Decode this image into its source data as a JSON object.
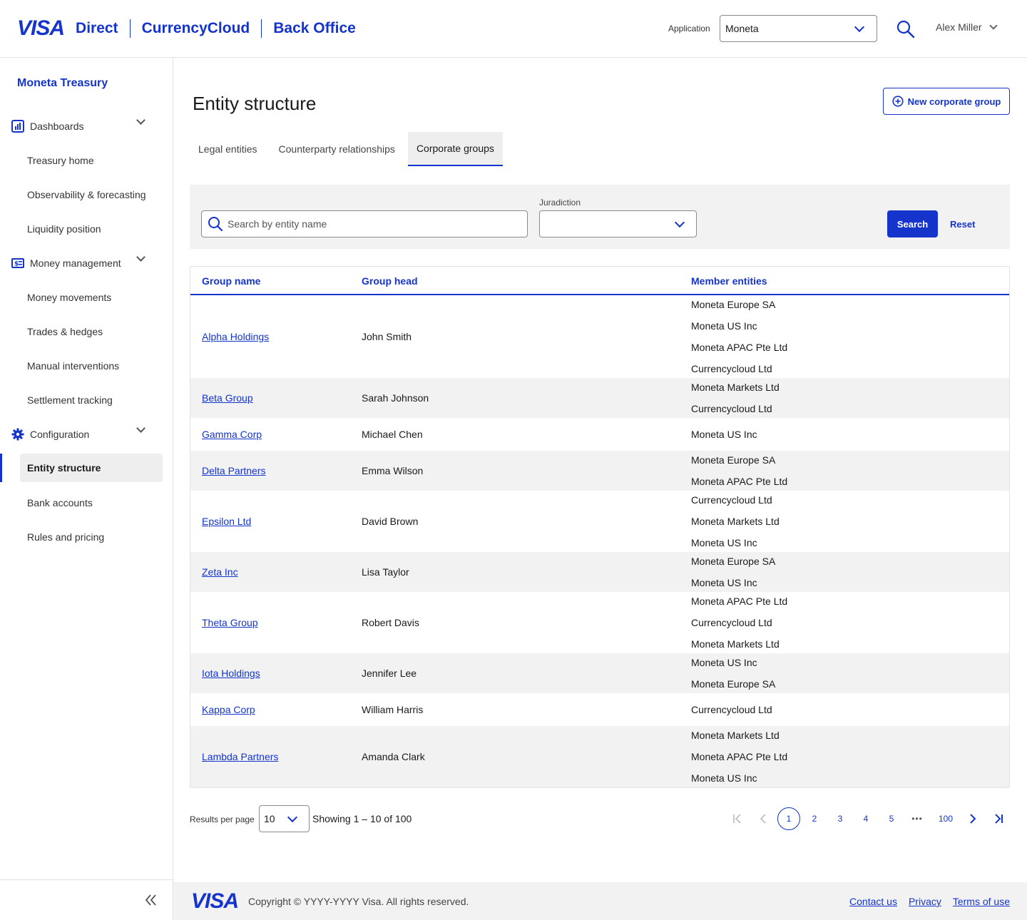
{
  "header": {
    "brand_logo": "VISA",
    "brand_items": [
      "Direct",
      "CurrencyCloud",
      "Back Office"
    ],
    "application_label": "Application",
    "application_value": "Moneta",
    "user_name": "Alex Miller"
  },
  "sidebar": {
    "title": "Moneta Treasury",
    "groups": [
      {
        "label": "Dashboards",
        "icon": "chart-icon",
        "items": [
          "Treasury home",
          "Observability & forecasting",
          "Liquidity position"
        ]
      },
      {
        "label": "Money management",
        "icon": "money-icon",
        "items": [
          "Money movements",
          "Trades & hedges",
          "Manual interventions",
          "Settlement tracking"
        ]
      },
      {
        "label": "Configuration",
        "icon": "gear-icon",
        "items": [
          "Entity structure",
          "Bank accounts",
          "Rules and pricing"
        ]
      }
    ],
    "active_item": "Entity structure"
  },
  "main": {
    "title": "Entity structure",
    "new_button_label": "New corporate group",
    "tabs": [
      "Legal entities",
      "Counterparty relationships",
      "Corporate groups"
    ],
    "active_tab": "Corporate groups",
    "filter": {
      "search_placeholder": "Search by entity name",
      "jurisdiction_label": "Juradiction",
      "jurisdiction_value": "",
      "search_button": "Search",
      "reset_button": "Reset"
    },
    "table": {
      "columns": [
        "Group name",
        "Group head",
        "Member entities"
      ],
      "rows": [
        {
          "group": "Alpha Holdings",
          "head": "John Smith",
          "members": [
            "Moneta Europe SA",
            "Moneta US Inc",
            "Moneta APAC Pte Ltd",
            "Currencycloud Ltd"
          ]
        },
        {
          "group": "Beta Group",
          "head": "Sarah Johnson",
          "members": [
            "Moneta Markets Ltd",
            "Currencycloud Ltd"
          ]
        },
        {
          "group": "Gamma Corp",
          "head": "Michael Chen",
          "members": [
            "Moneta US Inc"
          ]
        },
        {
          "group": "Delta Partners",
          "head": "Emma Wilson",
          "members": [
            "Moneta Europe SA",
            "Moneta APAC Pte Ltd"
          ]
        },
        {
          "group": "Epsilon Ltd",
          "head": "David Brown",
          "members": [
            "Currencycloud Ltd",
            "Moneta Markets Ltd",
            "Moneta US Inc"
          ]
        },
        {
          "group": "Zeta Inc",
          "head": "Lisa Taylor",
          "members": [
            "Moneta Europe SA",
            "Moneta US Inc"
          ]
        },
        {
          "group": "Theta Group",
          "head": "Robert Davis",
          "members": [
            "Moneta APAC Pte Ltd",
            "Currencycloud Ltd",
            "Moneta Markets Ltd"
          ]
        },
        {
          "group": "Iota Holdings",
          "head": "Jennifer Lee",
          "members": [
            "Moneta US Inc",
            "Moneta Europe SA"
          ]
        },
        {
          "group": "Kappa Corp",
          "head": "William Harris",
          "members": [
            "Currencycloud Ltd"
          ]
        },
        {
          "group": "Lambda Partners",
          "head": "Amanda Clark",
          "members": [
            "Moneta Markets Ltd",
            "Moneta APAC Pte Ltd",
            "Moneta US Inc"
          ]
        }
      ]
    },
    "pagination": {
      "results_per_page_label": "Results per page",
      "results_per_page": "10",
      "showing": "Showing 1 – 10 of 100",
      "pages": [
        "1",
        "2",
        "3",
        "4",
        "5",
        "100"
      ],
      "ellipsis": "•••",
      "current_page": "1"
    }
  },
  "footer": {
    "logo": "VISA",
    "copyright": "Copyright © YYYY-YYYY Visa. All rights reserved.",
    "links": [
      "Contact us",
      "Privacy",
      "Terms of use"
    ]
  },
  "colors": {
    "brand": "#1434cb",
    "row_alt": "#f2f2f2",
    "border": "#e2e2e2"
  }
}
